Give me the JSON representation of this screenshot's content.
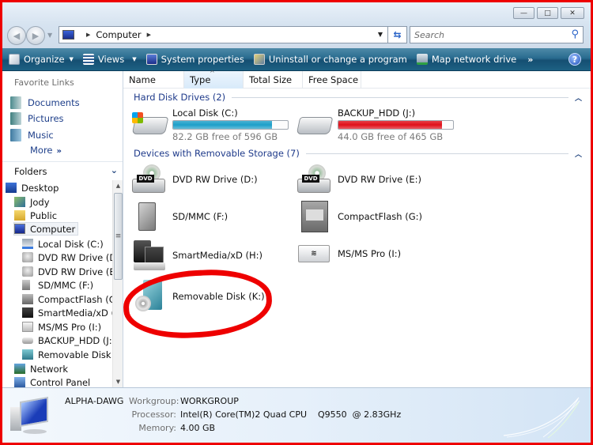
{
  "window": {
    "buttons": {
      "minimize": "—",
      "maximize": "□",
      "close": "✕"
    }
  },
  "address_bar": {
    "breadcrumbs": [
      "Computer"
    ],
    "search_placeholder": "Search"
  },
  "command_bar": {
    "items": [
      {
        "label": "Organize",
        "icon": "organize-icon",
        "has_dropdown": true
      },
      {
        "label": "Views",
        "icon": "views-icon",
        "has_dropdown": true
      },
      {
        "label": "System properties",
        "icon": "system-properties-icon"
      },
      {
        "label": "Uninstall or change a program",
        "icon": "uninstall-icon"
      },
      {
        "label": "Map network drive",
        "icon": "map-network-drive-icon"
      }
    ],
    "overflow": "»",
    "help": "?"
  },
  "favorite_links": {
    "title": "Favorite Links",
    "items": [
      {
        "label": "Documents"
      },
      {
        "label": "Pictures"
      },
      {
        "label": "Music"
      }
    ],
    "more": "More"
  },
  "folders": {
    "title": "Folders",
    "tree": [
      {
        "label": "Desktop",
        "level": 0
      },
      {
        "label": "Jody",
        "level": 1
      },
      {
        "label": "Public",
        "level": 1
      },
      {
        "label": "Computer",
        "level": 1,
        "selected": true
      },
      {
        "label": "Local Disk (C:)",
        "level": 2
      },
      {
        "label": "DVD RW Drive (D:)",
        "level": 2
      },
      {
        "label": "DVD RW Drive (E:)",
        "level": 2
      },
      {
        "label": "SD/MMC (F:)",
        "level": 2
      },
      {
        "label": "CompactFlash (G:)",
        "level": 2
      },
      {
        "label": "SmartMedia/xD (H",
        "level": 2
      },
      {
        "label": "MS/MS Pro (I:)",
        "level": 2
      },
      {
        "label": "BACKUP_HDD (J:)",
        "level": 2
      },
      {
        "label": "Removable Disk (K",
        "level": 2
      },
      {
        "label": "Network",
        "level": 1
      },
      {
        "label": "Control Panel",
        "level": 1
      }
    ]
  },
  "columns": [
    "Name",
    "Type",
    "Total Size",
    "Free Space"
  ],
  "sorted_column": "Type",
  "groups": {
    "hard_disks": {
      "title": "Hard Disk Drives (2)",
      "drives": [
        {
          "name": "Local Disk (C:)",
          "free_text": "82.2 GB free of 596 GB",
          "used_fraction": 0.862,
          "bar_color": "#1d9fc9"
        },
        {
          "name": "BACKUP_HDD (J:)",
          "free_text": "44.0 GB free of 465 GB",
          "used_fraction": 0.905,
          "bar_color": "#e0101a"
        }
      ]
    },
    "removable": {
      "title": "Devices with Removable Storage (7)",
      "drives": [
        {
          "name": "DVD RW Drive (D:)",
          "icon": "dvd-drive-icon"
        },
        {
          "name": "DVD RW Drive (E:)",
          "icon": "dvd-drive-icon"
        },
        {
          "name": "SD/MMC (F:)",
          "icon": "sd-card-icon"
        },
        {
          "name": "CompactFlash (G:)",
          "icon": "compactflash-icon"
        },
        {
          "name": "SmartMedia/xD (H:)",
          "icon": "smartmedia-icon"
        },
        {
          "name": "MS/MS Pro (I:)",
          "icon": "memory-stick-icon"
        },
        {
          "name": "Removable Disk (K:)",
          "icon": "removable-disk-icon"
        }
      ]
    }
  },
  "dvd_label": "DVD",
  "details_pane": {
    "computer_name": "ALPHA-DAWG",
    "workgroup_label": "Workgroup:",
    "workgroup": "WORKGROUP",
    "processor_label": "Processor:",
    "processor": "Intel(R) Core(TM)2 Quad CPU    Q9550  @ 2.83GHz",
    "memory_label": "Memory:",
    "memory": "4.00 GB"
  },
  "annotation": {
    "color": "#ee0000",
    "target": "Removable Disk (K:)"
  }
}
